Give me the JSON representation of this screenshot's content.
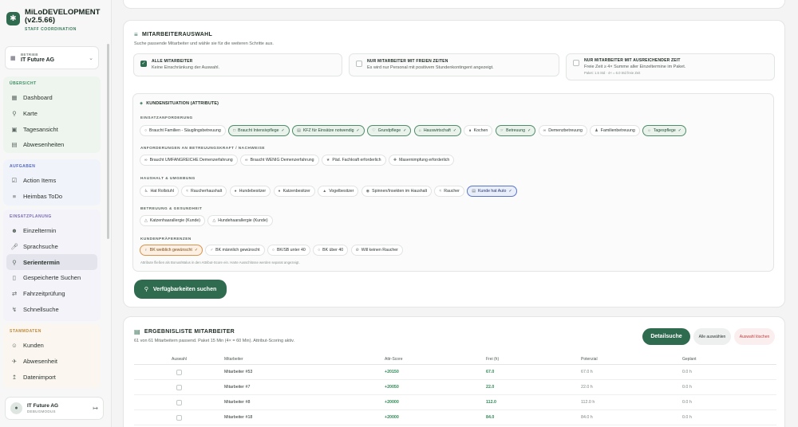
{
  "app": {
    "title": "MiLoDEVELOPMENT (v2.5.66)",
    "subtitle": "STAFF COORDINATION"
  },
  "betrieb": {
    "label": "BETRIEB",
    "value": "IT Future AG"
  },
  "nav_groups": [
    {
      "title": "ÜBERSICHT",
      "items": [
        {
          "label": "Dashboard",
          "icon": "grid-icon"
        },
        {
          "label": "Karte",
          "icon": "map-pin-icon"
        },
        {
          "label": "Tagesansicht",
          "icon": "calendar-day-icon"
        },
        {
          "label": "Abwesenheiten",
          "icon": "calendar-icon"
        }
      ]
    },
    {
      "title": "AUFGABEN",
      "items": [
        {
          "label": "Action Items",
          "icon": "checklist-icon"
        },
        {
          "label": "Heimbas ToDo",
          "icon": "tasks-icon"
        }
      ]
    },
    {
      "title": "EINSATZPLANUNG",
      "items": [
        {
          "label": "Einzeltermin",
          "icon": "user-add-icon"
        },
        {
          "label": "Sprachsuche",
          "icon": "microphone-icon"
        },
        {
          "label": "Serientermin",
          "icon": "users-search-icon",
          "active": true
        },
        {
          "label": "Gespeicherte Suchen",
          "icon": "bookmark-icon"
        },
        {
          "label": "Fahrzeitprüfung",
          "icon": "route-icon"
        },
        {
          "label": "Schnellsuche",
          "icon": "lightning-icon"
        }
      ]
    },
    {
      "title": "STAMMDATEN",
      "items": [
        {
          "label": "Kunden",
          "icon": "people-icon"
        },
        {
          "label": "Abwesenheit",
          "icon": "plane-icon"
        },
        {
          "label": "Datenimport",
          "icon": "upload-icon"
        }
      ]
    }
  ],
  "user": {
    "name": "IT Future AG",
    "role": "DEBUGMODUS"
  },
  "mitarbeiterauswahl": {
    "title": "MITARBEITERAUSWAHL",
    "subtitle": "Suche passende Mitarbeiter und wähle sie für die weiteren Schritte aus.",
    "options": [
      {
        "title": "ALLE MITARBEITER",
        "desc": "Keine Einschränkung der Auswahl.",
        "note": "",
        "checked": true
      },
      {
        "title": "NUR MITARBEITER MIT FREIEN ZEITEN",
        "desc": "Es wird nur Personal mit positivem Stundenkontingent angezeigt.",
        "note": "",
        "checked": false
      },
      {
        "title": "NUR MITARBEITER MIT AUSREICHENDER ZEIT",
        "desc": "Freie Zeit ≥ 4× Summe aller Einzeltermine im Paket.",
        "note": "Paket: 1.5 Std · 4× = 6.0 Std freie Zeit",
        "checked": false
      }
    ]
  },
  "kundensituation": {
    "title": "KUNDENSITUATION (ATTRIBUTE)",
    "categories": [
      {
        "title": "EINSATZANFORDERUNG",
        "chips": [
          {
            "label": "Braucht Familien - Säuglingsbetreuung",
            "state": "off",
            "icon": "person"
          },
          {
            "label": "Braucht Intensivpflege",
            "state": "on",
            "icon": "check-square"
          },
          {
            "label": "KFZ für Einsätze notwendig",
            "state": "on",
            "icon": "car"
          },
          {
            "label": "Grundpflege",
            "state": "on",
            "icon": "heart"
          },
          {
            "label": "Hauswirtschaft",
            "state": "on",
            "icon": "broom"
          },
          {
            "label": "Kochen",
            "state": "off",
            "icon": "cutlery"
          },
          {
            "label": "Betreuung",
            "state": "on",
            "icon": "hand"
          },
          {
            "label": "Demenzbetreuung",
            "state": "off",
            "icon": "brain"
          },
          {
            "label": "Familienbetreuung",
            "state": "off",
            "icon": "family"
          },
          {
            "label": "Tagespflege",
            "state": "on",
            "icon": "sun"
          }
        ]
      },
      {
        "title": "ANFORDERUNGEN AN BETREUUNGSKRAFT / NACHWEISE",
        "chips": [
          {
            "label": "Braucht UMFANGREICHE Demenzerfahrung",
            "state": "off",
            "icon": "brain"
          },
          {
            "label": "Braucht WENIG Demenzerfahrung",
            "state": "off",
            "icon": "brain"
          },
          {
            "label": "Päd. Fachkraft erforderlich",
            "state": "off",
            "icon": "badge"
          },
          {
            "label": "Masernimpfung erforderlich",
            "state": "off",
            "icon": "syringe"
          }
        ]
      },
      {
        "title": "HAUSHALT & UMGEBUNG",
        "chips": [
          {
            "label": "Hat Rollstuhl",
            "state": "off",
            "icon": "wheelchair"
          },
          {
            "label": "Raucherhaushalt",
            "state": "off",
            "icon": "smoke"
          },
          {
            "label": "Hundebesitzer",
            "state": "off",
            "icon": "paw"
          },
          {
            "label": "Katzenbesitzer",
            "state": "off",
            "icon": "paw"
          },
          {
            "label": "Vogelbesitzer",
            "state": "off",
            "icon": "bird"
          },
          {
            "label": "Spinnen/Insekten im Haushalt",
            "state": "off",
            "icon": "bug"
          },
          {
            "label": "Raucher",
            "state": "off",
            "icon": "smoke"
          },
          {
            "label": "Kunde hat Auto",
            "state": "blue",
            "icon": "car"
          }
        ]
      },
      {
        "title": "BETREUUNG & GESUNDHEIT",
        "chips": [
          {
            "label": "Katzenhaarallergie (Kunde)",
            "state": "off",
            "icon": "warning"
          },
          {
            "label": "Hundehaarallergie (Kunde)",
            "state": "off",
            "icon": "warning"
          }
        ]
      },
      {
        "title": "KUNDENPRÄFERENZEN",
        "chips": [
          {
            "label": "BK weiblich gewünscht",
            "state": "orange",
            "icon": "female"
          },
          {
            "label": "BK männlich gewünscht",
            "state": "off",
            "icon": "male"
          },
          {
            "label": "BK/SB unter 40",
            "state": "off",
            "icon": "person"
          },
          {
            "label": "BK über 40",
            "state": "off",
            "icon": "person"
          },
          {
            "label": "Will keinen Raucher",
            "state": "off",
            "icon": "no-smoke"
          }
        ]
      }
    ],
    "hint": "Attribute fließen als Bonus/Malus in den Attribut-Score ein. Harte Ausschlüsse werden separat angezeigt."
  },
  "search_button": "Verfügbarkeiten suchen",
  "ergebnis": {
    "title": "ERGEBNISLISTE MITARBEITER",
    "subtitle": "61 von 61 Mitarbeitern passend. Paket 15 Min (4× = 60 Min). Attribut-Scoring aktiv.",
    "buttons": {
      "detail": "Detailsuche",
      "all": "Alle auswählen",
      "clear": "Auswahl löschen"
    },
    "columns": [
      "Auswahl",
      "Mitarbeiter",
      "Attr-Score",
      "Frei (h)",
      "Potenzial",
      "Geplant"
    ],
    "rows": [
      {
        "name": "Mitarbeiter #53",
        "score": "+20150",
        "frei": "67.0",
        "potenzial": "67.0 h",
        "geplant": "0.0 h"
      },
      {
        "name": "Mitarbeiter #7",
        "score": "+20050",
        "frei": "22.0",
        "potenzial": "22.0 h",
        "geplant": "0.0 h"
      },
      {
        "name": "Mitarbeiter #8",
        "score": "+20000",
        "frei": "112.0",
        "potenzial": "112.0 h",
        "geplant": "0.0 h"
      },
      {
        "name": "Mitarbeiter #18",
        "score": "+20000",
        "frei": "84.0",
        "potenzial": "84.0 h",
        "geplant": "0.0 h"
      }
    ]
  },
  "colors": {
    "primary": "#2f6b4f",
    "selected_chip": "#4f8c68",
    "blue_chip": "#5b76c9",
    "orange_chip": "#d9934d",
    "danger": "#c23b3b"
  }
}
